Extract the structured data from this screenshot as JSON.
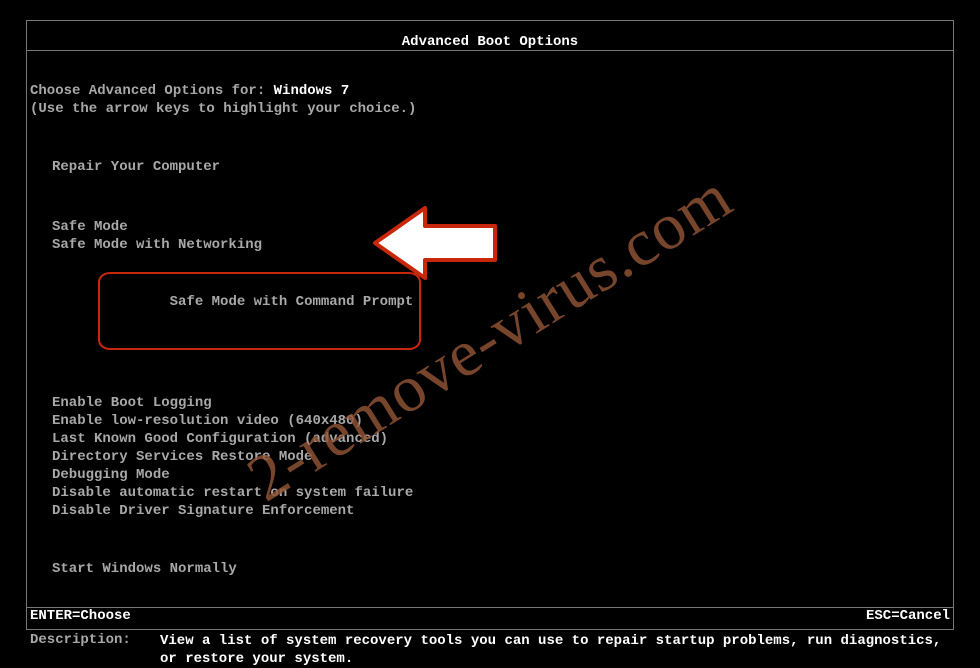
{
  "header": {
    "title": "Advanced Boot Options"
  },
  "prompt": {
    "prefix": "Choose Advanced Options for: ",
    "os": "Windows 7",
    "hint": "(Use the arrow keys to highlight your choice.)"
  },
  "group1": {
    "items": [
      "Repair Your Computer"
    ]
  },
  "group2": {
    "items": [
      "Safe Mode",
      "Safe Mode with Networking",
      "Safe Mode with Command Prompt"
    ],
    "highlighted_index": 2
  },
  "group3": {
    "items": [
      "Enable Boot Logging",
      "Enable low-resolution video (640x480)",
      "Last Known Good Configuration (advanced)",
      "Directory Services Restore Mode",
      "Debugging Mode",
      "Disable automatic restart on system failure",
      "Disable Driver Signature Enforcement"
    ]
  },
  "group4": {
    "items": [
      "Start Windows Normally"
    ]
  },
  "description": {
    "label": "Description:",
    "text": "View a list of system recovery tools you can use to repair startup problems, run diagnostics, or restore your system."
  },
  "footer": {
    "left": "ENTER=Choose",
    "right": "ESC=Cancel"
  },
  "watermark": "2-remove-virus.com"
}
